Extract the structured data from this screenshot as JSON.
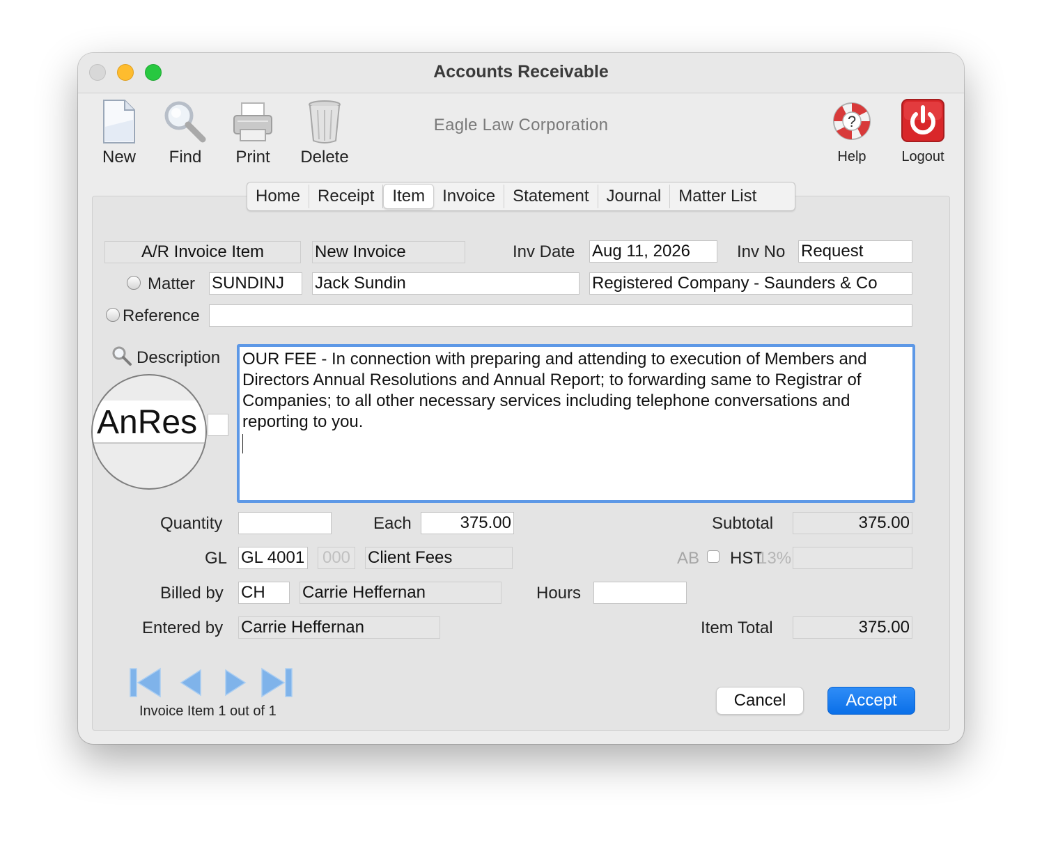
{
  "window": {
    "title": "Accounts Receivable"
  },
  "toolbar": {
    "new_label": "New",
    "find_label": "Find",
    "print_label": "Print",
    "delete_label": "Delete",
    "company": "Eagle Law Corporation",
    "help_label": "Help",
    "logout_label": "Logout"
  },
  "tabs": [
    {
      "label": "Home"
    },
    {
      "label": "Receipt"
    },
    {
      "label": "Item",
      "active": true
    },
    {
      "label": "Invoice"
    },
    {
      "label": "Statement"
    },
    {
      "label": "Journal"
    },
    {
      "label": "Matter List"
    }
  ],
  "form": {
    "header_left": "A/R Invoice Item",
    "header_status": "New Invoice",
    "inv_date_label": "Inv Date",
    "inv_date_value": "Aug 11, 2026",
    "inv_no_label": "Inv No",
    "inv_no_value": "Request",
    "matter_label": "Matter",
    "matter_code": "SUNDINJ",
    "matter_client": "Jack Sundin",
    "matter_desc": "Registered Company - Saunders & Co",
    "reference_label": "Reference",
    "reference_value": "",
    "description_label": "Description",
    "description_code_zoom": "AnRes",
    "description_text": "OUR FEE - In connection with preparing and attending to execution of Members and Directors Annual Resolutions and Annual Report; to forwarding same to Registrar of Companies; to all other necessary services including telephone conversations and reporting to you.",
    "quantity_label": "Quantity",
    "quantity_value": "",
    "each_label": "Each",
    "each_value": "375.00",
    "subtotal_label": "Subtotal",
    "subtotal_value": "375.00",
    "gl_label": "GL",
    "gl_value": "GL 4001",
    "gl_sub": "000",
    "gl_name": "Client Fees",
    "ab_label": "AB",
    "hst_label": "HST",
    "hst_rate": "13%",
    "hst_value": "",
    "billed_by_label": "Billed by",
    "billed_by_code": "CH",
    "billed_by_name": "Carrie Heffernan",
    "hours_label": "Hours",
    "hours_value": "",
    "entered_by_label": "Entered by",
    "entered_by_value": "Carrie Heffernan",
    "item_total_label": "Item Total",
    "item_total_value": "375.00"
  },
  "navigation": {
    "status": "Invoice Item 1 out of 1"
  },
  "buttons": {
    "cancel": "Cancel",
    "accept": "Accept"
  },
  "colors": {
    "accent": "#0a6fe8",
    "focus": "#5d98e6",
    "logout": "#d9272a"
  }
}
